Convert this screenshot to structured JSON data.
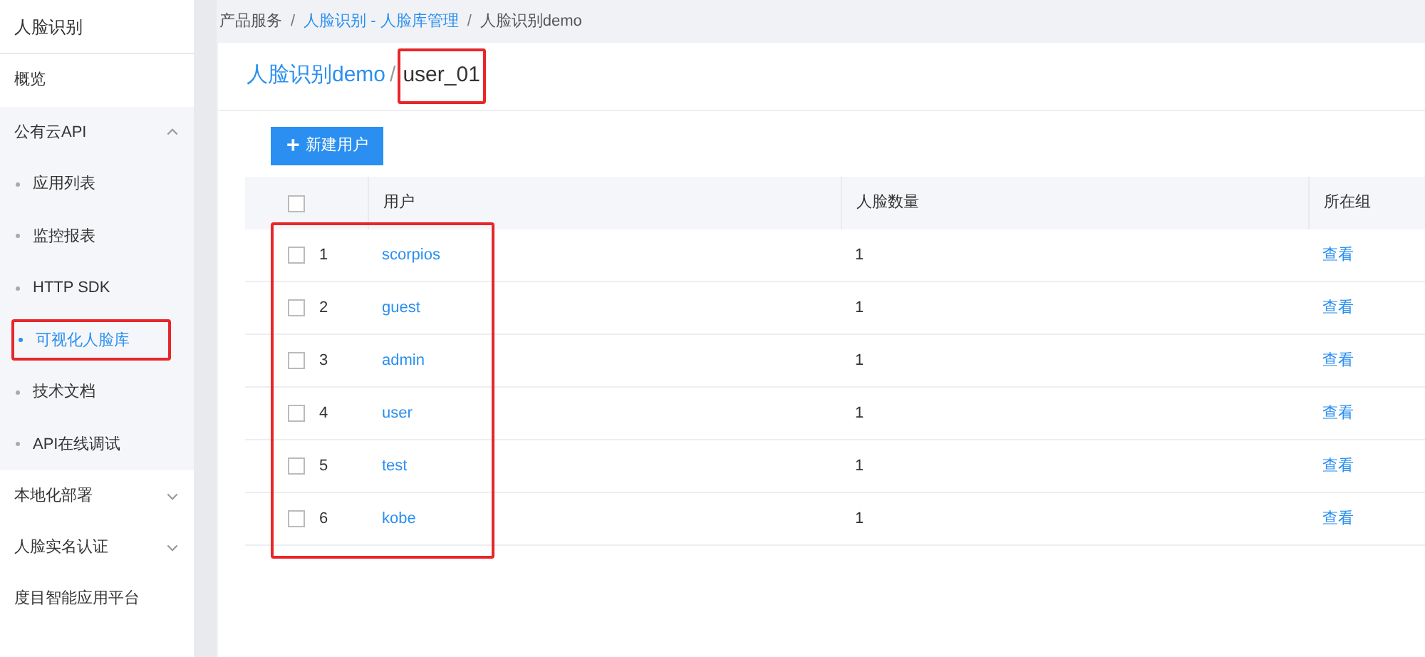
{
  "sidebar": {
    "title": "人脸识别",
    "items": [
      {
        "kind": "link",
        "label": "概览"
      },
      {
        "kind": "group",
        "label": "公有云API",
        "expanded": true,
        "children": [
          {
            "label": "应用列表",
            "selected": false,
            "highlighted": false
          },
          {
            "label": "监控报表",
            "selected": false,
            "highlighted": false
          },
          {
            "label": "HTTP SDK",
            "selected": false,
            "highlighted": false
          },
          {
            "label": "可视化人脸库",
            "selected": true,
            "highlighted": true
          },
          {
            "label": "技术文档",
            "selected": false,
            "highlighted": false
          },
          {
            "label": "API在线调试",
            "selected": false,
            "highlighted": false
          }
        ]
      },
      {
        "kind": "group",
        "label": "本地化部署",
        "expanded": false
      },
      {
        "kind": "group",
        "label": "人脸实名认证",
        "expanded": false
      },
      {
        "kind": "link",
        "label": "度目智能应用平台"
      }
    ]
  },
  "breadcrumb": [
    {
      "kind": "text",
      "label": "产品服务"
    },
    {
      "kind": "separator",
      "label": "/"
    },
    {
      "kind": "link",
      "label": "人脸识别 - 人脸库管理"
    },
    {
      "kind": "separator",
      "label": "/"
    },
    {
      "kind": "text",
      "label": "人脸识别demo"
    }
  ],
  "title": {
    "parent": "人脸识别demo",
    "separator": "/",
    "current": "user_01",
    "highlighted": true
  },
  "new_button": {
    "icon": "+",
    "label": "新建用户"
  },
  "table": {
    "all_checked": false,
    "columns": [
      "用户",
      "人脸数量",
      "所在组"
    ],
    "rows_highlighted": true,
    "rows": [
      {
        "checked": false,
        "index": "1",
        "user": "scorpios",
        "faces": "1",
        "group": "查看"
      },
      {
        "checked": false,
        "index": "2",
        "user": "guest",
        "faces": "1",
        "group": "查看"
      },
      {
        "checked": false,
        "index": "3",
        "user": "admin",
        "faces": "1",
        "group": "查看"
      },
      {
        "checked": false,
        "index": "4",
        "user": "user",
        "faces": "1",
        "group": "查看"
      },
      {
        "checked": false,
        "index": "5",
        "user": "test",
        "faces": "1",
        "group": "查看"
      },
      {
        "checked": false,
        "index": "6",
        "user": "kobe",
        "faces": "1",
        "group": "查看"
      }
    ]
  }
}
